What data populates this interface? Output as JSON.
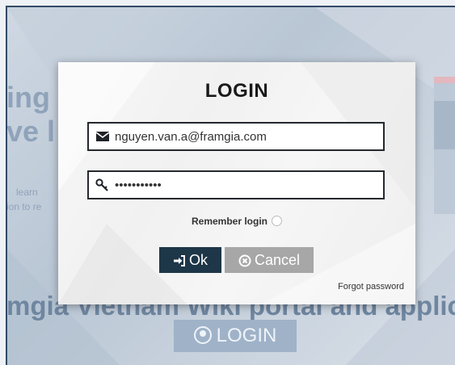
{
  "background": {
    "heading_line1": "ing",
    "heading_line2": "ve l",
    "small_line1": "learn",
    "small_line2": "ion to re",
    "bottom_text": "mgia Vietnam Wiki portal and applica",
    "login_button_label": "LOGIN",
    "login_icon": "user-circle-icon"
  },
  "modal": {
    "title": "LOGIN",
    "email": {
      "icon": "envelope-icon",
      "value": "nguyen.van.a@framgia.com"
    },
    "password": {
      "icon": "key-icon",
      "value": "•••••••••••"
    },
    "remember_label": "Remember login",
    "ok_label": "Ok",
    "ok_icon": "sign-in-icon",
    "cancel_label": "Cancel",
    "cancel_icon": "times-circle-icon",
    "forgot_label": "Forgot password"
  },
  "colors": {
    "ok_button": "#1d3648",
    "cancel_button": "#a7a7a7",
    "field_border": "#25292e"
  }
}
